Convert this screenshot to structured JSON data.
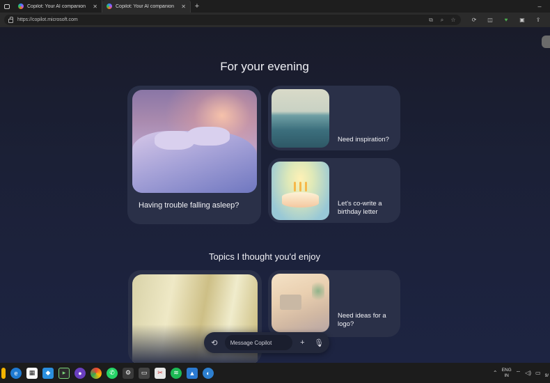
{
  "browser": {
    "tabs": [
      {
        "title": "Copilot: Your AI companion",
        "active": false
      },
      {
        "title": "Copilot: Your AI companion",
        "active": true
      }
    ],
    "new_tab": "+",
    "minimize": "–",
    "address": "https://copilot.microsoft.com"
  },
  "sections": {
    "evening_title": "For your evening",
    "topics_title": "Topics I thought you'd enjoy"
  },
  "cards": {
    "sleep": "Having trouble falling asleep?",
    "inspiration": "Need inspiration?",
    "birthday": "Let's co-write a birthday letter",
    "logo": "Need ideas for a logo?"
  },
  "composer": {
    "placeholder": "Message Copilot",
    "history_icon": "history-icon",
    "add_icon": "plus-icon",
    "mic_icon": "microphone-icon"
  },
  "taskbar": {
    "lang_line1": "ENG",
    "lang_line2": "IN",
    "clock_partial_1": "",
    "clock_partial_2": "9/"
  },
  "colors": {
    "page_bg": "#1b2036",
    "card_bg": "#2a3048",
    "tab_bar": "#1e1e1e"
  }
}
